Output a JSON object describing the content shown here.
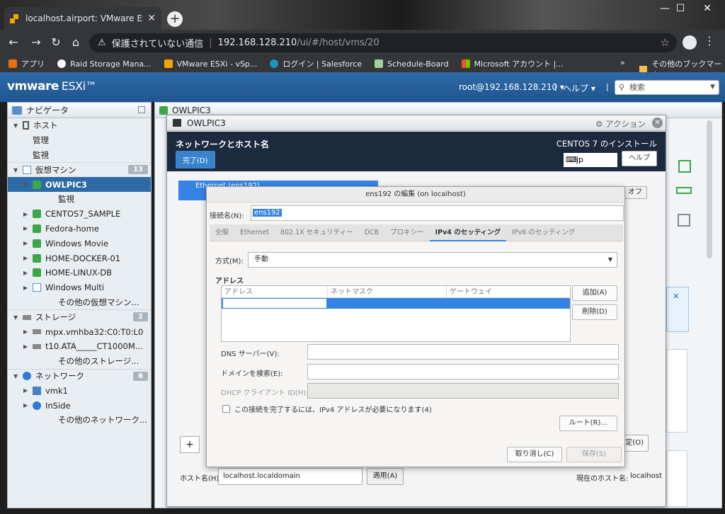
{
  "browser": {
    "tab_title": "localhost.airport: VMware ESXi",
    "url_warning": "保護されていない通信",
    "url_host": "192.168.128.210",
    "url_path": "/ui/#/host/vms/20",
    "bookmarks": [
      {
        "label": "アプリ",
        "color": "#e8710a"
      },
      {
        "label": "Raid Storage Mana...",
        "color": "#ffffff"
      },
      {
        "label": "VMware ESXi - vSp...",
        "color": "#f5a300"
      },
      {
        "label": "ログイン | Salesforce",
        "color": "#1798c1"
      },
      {
        "label": "Schedule-Board",
        "color": "#9fd39a"
      },
      {
        "label": "Microsoft アカウント |...",
        "color": "#f25022"
      }
    ],
    "bookmarks_more": "»",
    "other_bookmarks": "その他のブックマーク"
  },
  "esxi": {
    "logo_vm": "vmware",
    "logo_product": "ESXi™",
    "user": "root@192.168.128.210 ▾",
    "help": "ヘルプ ▾",
    "search_placeholder": "検索"
  },
  "navigator": {
    "title": "ナビゲータ",
    "rows": [
      {
        "label": "ホスト",
        "level": 0,
        "tw": "▼",
        "icon": "host",
        "group": true
      },
      {
        "label": "管理",
        "level": 1,
        "tw": "",
        "icon": ""
      },
      {
        "label": "監視",
        "level": 1,
        "tw": "",
        "icon": ""
      },
      {
        "label": "仮想マシン",
        "level": 0,
        "tw": "▼",
        "icon": "vmg",
        "badge": "13",
        "group": true
      },
      {
        "label": "OWLPIC3",
        "level": 1,
        "tw": "▼",
        "icon": "vm",
        "selected": true
      },
      {
        "label": "監視",
        "level": 2,
        "tw": "",
        "icon": ""
      },
      {
        "label": "CENTOS7_SAMPLE",
        "level": 1,
        "tw": "▶",
        "icon": "vm"
      },
      {
        "label": "Fedora-home",
        "level": 1,
        "tw": "▶",
        "icon": "vm"
      },
      {
        "label": "Windows Movie",
        "level": 1,
        "tw": "▶",
        "icon": "vm"
      },
      {
        "label": "HOME-DOCKER-01",
        "level": 1,
        "tw": "▶",
        "icon": "vm"
      },
      {
        "label": "HOME-LINUX-DB",
        "level": 1,
        "tw": "▶",
        "icon": "vm"
      },
      {
        "label": "Windows Multi",
        "level": 1,
        "tw": "▶",
        "icon": "vmg"
      },
      {
        "label": "その他の仮想マシン...",
        "level": 2,
        "tw": "",
        "icon": ""
      },
      {
        "label": "ストレージ",
        "level": 0,
        "tw": "▼",
        "icon": "disk",
        "badge": "2",
        "group": true
      },
      {
        "label": "mpx.vmhba32:C0:T0:L0",
        "level": 1,
        "tw": "▶",
        "icon": "disk"
      },
      {
        "label": "t10.ATA_____CT1000M...",
        "level": 1,
        "tw": "▶",
        "icon": "disk"
      },
      {
        "label": "その他のストレージ...",
        "level": 2,
        "tw": "",
        "icon": ""
      },
      {
        "label": "ネットワーク",
        "level": 0,
        "tw": "▼",
        "icon": "net",
        "badge": "6",
        "group": true
      },
      {
        "label": "vmk1",
        "level": 1,
        "tw": "▶",
        "icon": "nic"
      },
      {
        "label": "InSide",
        "level": 1,
        "tw": "▶",
        "icon": "net"
      },
      {
        "label": "その他のネットワーク...",
        "level": 2,
        "tw": "",
        "icon": ""
      }
    ]
  },
  "main": {
    "title": "OWLPIC3"
  },
  "console": {
    "title": "OWLPIC3",
    "actions": "アクション",
    "heading": "ネットワークとホスト名",
    "done_button": "完了(D)",
    "installer_title": "CENTOS 7 のインストール",
    "keyboard": "jp",
    "help_button": "ヘルプ",
    "ethernet_item": "Ethernet (ens192)",
    "toggle_off": "オフ",
    "add_button": "+",
    "config_button": "設定(O)",
    "hostname_label": "ホスト名(H):",
    "hostname_value": "localhost.localdomain",
    "apply_button": "適用(A)",
    "current_hostname_label": "現在のホスト名:",
    "current_hostname_value": "localhost"
  },
  "dialog": {
    "title": "ens192 の編集 (on localhost)",
    "connection_label": "接続名(N):",
    "connection_value": "ens192",
    "tabs": [
      {
        "label": "全般",
        "active": false
      },
      {
        "label": "Ethernet",
        "active": false
      },
      {
        "label": "802.1X セキュリティー",
        "active": false
      },
      {
        "label": "DCB",
        "active": false
      },
      {
        "label": "プロキシー",
        "active": false
      },
      {
        "label": "IPv4 のセッティング",
        "active": true
      },
      {
        "label": "IPv6 のセッティング",
        "active": false
      }
    ],
    "method_label": "方式(M):",
    "method_value": "手動",
    "address_heading": "アドレス",
    "columns": [
      "アドレス",
      "ネットマスク",
      "ゲートウェイ"
    ],
    "add_button": "追加(A)",
    "delete_button": "削除(D)",
    "dns_label": "DNS サーバー(V):",
    "search_domain_label": "ドメインを検索(E):",
    "dhcp_label": "DHCP クライアント ID(H):",
    "require_ipv4_label": "この接続を完了するには、IPv4 アドレスが必要になります(4)",
    "route_button": "ルート(R)…",
    "cancel_button": "取り消し(C)",
    "save_button": "保存(S)"
  }
}
